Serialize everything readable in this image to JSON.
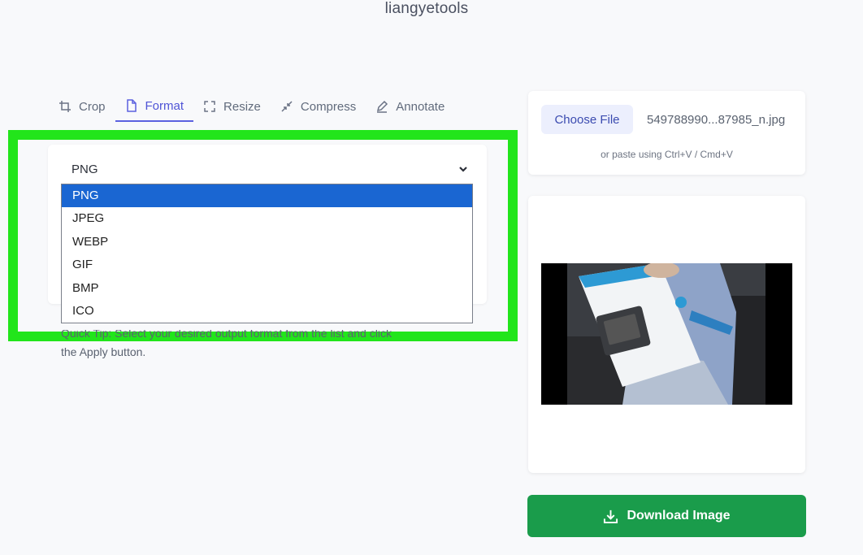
{
  "site": {
    "title": "liangyetools"
  },
  "tabs": [
    {
      "label": "Crop",
      "icon": "crop-icon",
      "active": false
    },
    {
      "label": "Format",
      "icon": "file-icon",
      "active": true
    },
    {
      "label": "Resize",
      "icon": "expand-icon",
      "active": false
    },
    {
      "label": "Compress",
      "icon": "compress-icon",
      "active": false
    },
    {
      "label": "Annotate",
      "icon": "pen-icon",
      "active": false
    }
  ],
  "format_select": {
    "selected": "PNG",
    "options": [
      "PNG",
      "JPEG",
      "WEBP",
      "GIF",
      "BMP",
      "ICO"
    ]
  },
  "tip": {
    "line1": "Quick Tip: Select your desired output format from the list and click",
    "line2": "the Apply button."
  },
  "file_upload": {
    "choose_label": "Choose File",
    "file_name": "549788990...87985_n.jpg",
    "paste_hint": "or paste using Ctrl+V / Cmd+V"
  },
  "download": {
    "label": "Download Image"
  },
  "colors": {
    "accent": "#5b61e0",
    "highlight": "#22e51b",
    "option_selected": "#1a66d2",
    "download": "#1a9c4b"
  }
}
